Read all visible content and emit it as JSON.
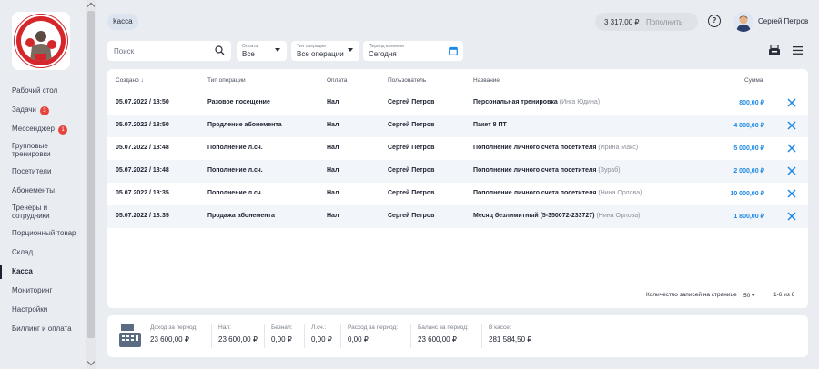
{
  "sidebar": {
    "items": [
      {
        "label": "Рабочий стол"
      },
      {
        "label": "Задачи",
        "badge": "3"
      },
      {
        "label": "Мессенджер",
        "badge": "1"
      },
      {
        "label": "Групповые тренировки"
      },
      {
        "label": "Посетители"
      },
      {
        "label": "Абонементы"
      },
      {
        "label": "Тренеры и сотрудники"
      },
      {
        "label": "Порционный товар"
      },
      {
        "label": "Склад"
      },
      {
        "label": "Касса",
        "active": true
      },
      {
        "label": "Мониторинг"
      },
      {
        "label": "Настройки"
      },
      {
        "label": "Биллинг и оплата"
      }
    ]
  },
  "header": {
    "breadcrumb": "Касса",
    "balance": "3 317,00 ₽",
    "topup_label": "Пополнить",
    "help": "?",
    "user_name": "Сергей Петров"
  },
  "filters": {
    "search_placeholder": "Поиск",
    "payment_label": "Оплата",
    "payment_value": "Все",
    "optype_label": "Тип операции",
    "optype_value": "Все операции",
    "period_label": "Период времени",
    "period_value": "Сегодня"
  },
  "table": {
    "columns": {
      "created": "Создано",
      "optype": "Тип операции",
      "payment": "Оплата",
      "user": "Пользователь",
      "name": "Название",
      "amount": "Сумма"
    },
    "rows": [
      {
        "created": "05.07.2022 / 18:50",
        "optype": "Разовое посещение",
        "payment": "Нал",
        "user": "Сергей Петров",
        "name": "Персональная тренировка",
        "extra": "(Инга Юдина)",
        "amount": "800,00 ₽"
      },
      {
        "created": "05.07.2022 / 18:50",
        "optype": "Продление абонемента",
        "payment": "Нал",
        "user": "Сергей Петров",
        "name": "Пакет 8 ПТ",
        "extra": "",
        "amount": "4 000,00 ₽"
      },
      {
        "created": "05.07.2022 / 18:48",
        "optype": "Пополнение л.сч.",
        "payment": "Нал",
        "user": "Сергей Петров",
        "name": "Пополнение личного счета посетителя",
        "extra": "(Ирина Макс)",
        "amount": "5 000,00 ₽"
      },
      {
        "created": "05.07.2022 / 18:48",
        "optype": "Пополнение л.сч.",
        "payment": "Нал",
        "user": "Сергей Петров",
        "name": "Пополнение личного счета посетителя",
        "extra": "(Зураб)",
        "amount": "2 000,00 ₽"
      },
      {
        "created": "05.07.2022 / 18:35",
        "optype": "Пополнение л.сч.",
        "payment": "Нал",
        "user": "Сергей Петров",
        "name": "Пополнение личного счета посетителя",
        "extra": "(Нина Орлова)",
        "amount": "10 000,00 ₽"
      },
      {
        "created": "05.07.2022 / 18:35",
        "optype": "Продажа абонемента",
        "payment": "Нал",
        "user": "Сергей Петров",
        "name": "Месяц безлимитный (5-350072-233727)",
        "extra": "(Нина Орлова)",
        "amount": "1 800,00 ₽"
      }
    ],
    "pager_label": "Количество записей на странице",
    "page_size": "50",
    "range": "1-6 из 6"
  },
  "summary": {
    "income_label": "Доход за период:",
    "income_value": "23 600,00 ₽",
    "cash_label": "Нал:",
    "cash_value": "23 600,00 ₽",
    "card_label": "Безнал:",
    "card_value": "0,00 ₽",
    "account_label": "Л.сч.:",
    "account_value": "0,00 ₽",
    "expense_label": "Расход за период:",
    "expense_value": "0,00 ₽",
    "balance_label": "Баланс за период:",
    "balance_value": "23 600,00 ₽",
    "till_label": "В кассе:",
    "till_value": "281 584,50 ₽"
  },
  "colors": {
    "accent": "#1e88e5",
    "badge": "#e5453c",
    "logo": "#d4262b"
  }
}
